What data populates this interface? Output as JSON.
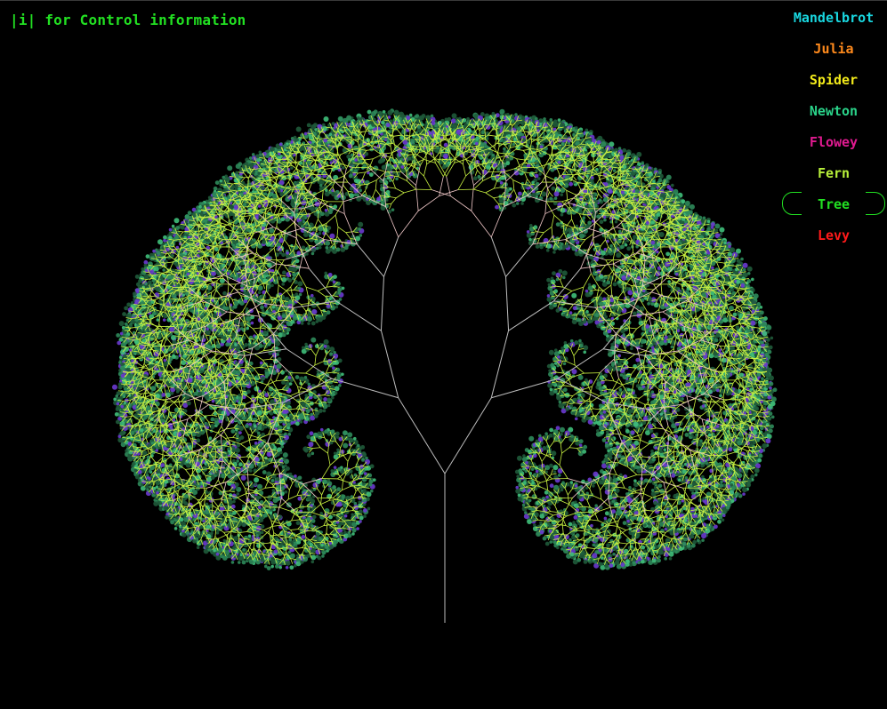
{
  "hint": {
    "text": "|i| for Control information",
    "color": "#22e022"
  },
  "menu": {
    "items": [
      {
        "label": "Mandelbrot",
        "color": "#19d7e0",
        "selected": false
      },
      {
        "label": "Julia",
        "color": "#ff8a1c",
        "selected": false
      },
      {
        "label": "Spider",
        "color": "#f2ea1a",
        "selected": false
      },
      {
        "label": "Newton",
        "color": "#2ad48a",
        "selected": false
      },
      {
        "label": "Flowey",
        "color": "#e01a90",
        "selected": false
      },
      {
        "label": "Fern",
        "color": "#b8f03a",
        "selected": false
      },
      {
        "label": "Tree",
        "color": "#22e022",
        "selected": true
      },
      {
        "label": "Levy",
        "color": "#ff1a1a",
        "selected": false
      }
    ]
  },
  "fractal": {
    "type": "tree",
    "colors": {
      "trunk": "#bdbdbd",
      "mid_branch": "#f2c9c9",
      "twig": "#c8f040",
      "leaf_dark": "#1f5a3a",
      "leaf_mid": "#2e8a5a",
      "leaf_light": "#3fbf7a",
      "leaf_purple": "#6a3ad0"
    }
  }
}
